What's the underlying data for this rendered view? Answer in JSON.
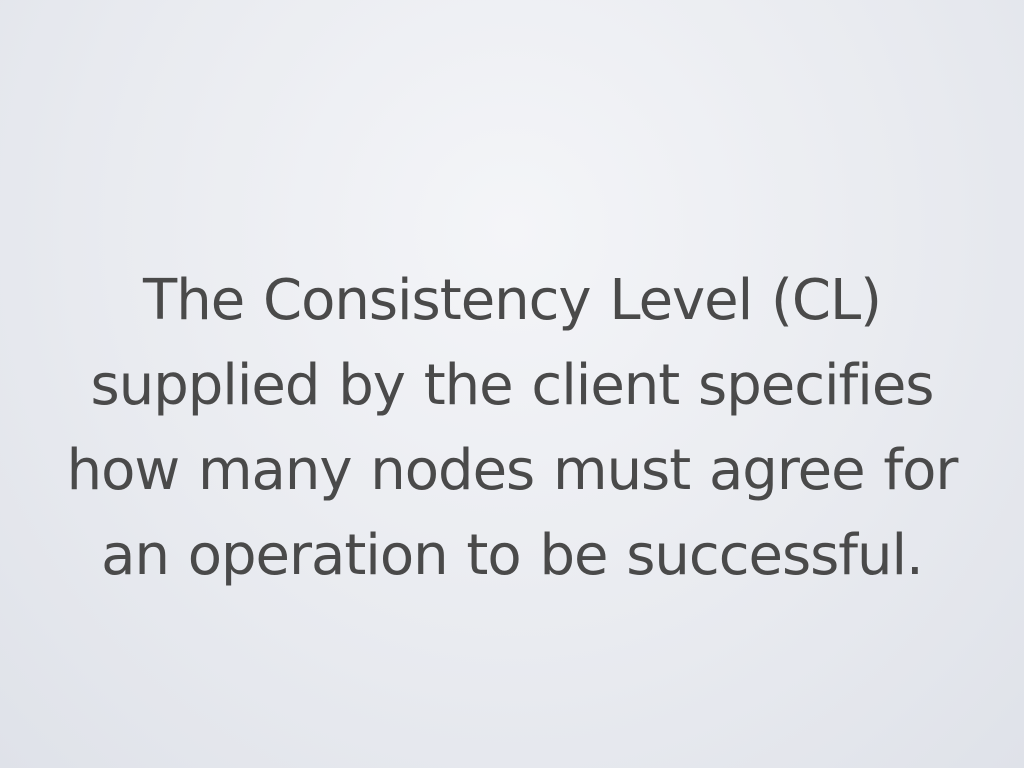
{
  "slide": {
    "lines": [
      "The Consistency Level (CL)",
      "supplied by the client specifies",
      "how many nodes must agree for",
      "an operation to be successful."
    ]
  },
  "colors": {
    "text": "#4a4a4a",
    "background": "#e9ebf0"
  }
}
